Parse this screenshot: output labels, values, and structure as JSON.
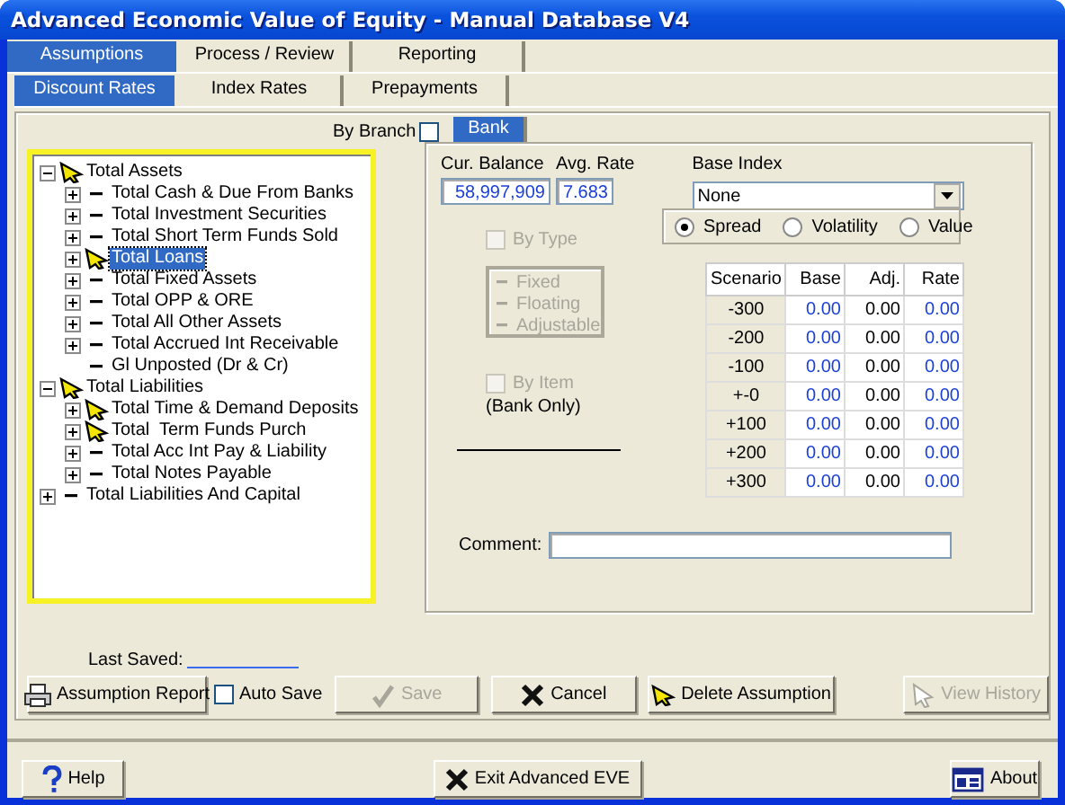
{
  "window": {
    "title": "Advanced Economic Value of Equity - Manual Database V4"
  },
  "tabs": [
    {
      "label": "Assumptions",
      "selected": true
    },
    {
      "label": "Process / Review",
      "selected": false
    },
    {
      "label": "Reporting",
      "selected": false
    }
  ],
  "subtabs": [
    {
      "label": "Discount Rates",
      "selected": true
    },
    {
      "label": "Index Rates",
      "selected": false
    },
    {
      "label": "Prepayments",
      "selected": false
    }
  ],
  "by_branch": {
    "label": "By Branch",
    "checked": false
  },
  "tree": [
    {
      "label": "Total Assets",
      "kind": "pointer",
      "expandable": true,
      "selected": false,
      "children": [
        {
          "label": "Total Cash & Due From Banks",
          "kind": "dash",
          "expandable": true,
          "selected": false
        },
        {
          "label": "Total Investment Securities",
          "kind": "dash",
          "expandable": true,
          "selected": false
        },
        {
          "label": "Total Short Term Funds Sold",
          "kind": "dash",
          "expandable": true,
          "selected": false
        },
        {
          "label": "Total Loans",
          "kind": "pointer",
          "expandable": true,
          "selected": true
        },
        {
          "label": "Total Fixed Assets",
          "kind": "dash",
          "expandable": true,
          "selected": false
        },
        {
          "label": "Total OPP & ORE",
          "kind": "dash",
          "expandable": true,
          "selected": false
        },
        {
          "label": "Total All Other Assets",
          "kind": "dash",
          "expandable": true,
          "selected": false
        },
        {
          "label": "Total Accrued Int Receivable",
          "kind": "dash",
          "expandable": true,
          "selected": false
        },
        {
          "label": "Gl Unposted (Dr & Cr)",
          "kind": "dash",
          "expandable": false,
          "selected": false
        }
      ]
    },
    {
      "label": "Total Liabilities",
      "kind": "pointer",
      "expandable": true,
      "selected": false,
      "children": [
        {
          "label": "Total Time & Demand Deposits",
          "kind": "pointer",
          "expandable": true,
          "selected": false
        },
        {
          "label": "Total  Term Funds Purch",
          "kind": "pointer",
          "expandable": true,
          "selected": false
        },
        {
          "label": "Total Acc Int Pay & Liability",
          "kind": "dash",
          "expandable": true,
          "selected": false
        },
        {
          "label": "Total Notes Payable",
          "kind": "dash",
          "expandable": true,
          "selected": false
        }
      ]
    },
    {
      "label": "Total Liabilities And Capital",
      "kind": "dash",
      "expandable": true,
      "selected": false
    }
  ],
  "panel": {
    "tab": "Bank",
    "cur_balance": {
      "label": "Cur. Balance",
      "value": "58,997,909"
    },
    "avg_rate": {
      "label": "Avg. Rate",
      "value": "7.683"
    },
    "base_index": {
      "label": "Base Index",
      "value": "None"
    },
    "by_type": {
      "label": "By Type",
      "checked": false,
      "disabled": true
    },
    "types": [
      "Fixed",
      "Floating",
      "Adjustable"
    ],
    "modes": [
      {
        "label": "Spread",
        "selected": true
      },
      {
        "label": "Volatility",
        "selected": false
      },
      {
        "label": "Value",
        "selected": false
      }
    ],
    "table": {
      "columns": [
        {
          "label": "Scenario",
          "kind": "label"
        },
        {
          "label": "Base",
          "kind": "computed"
        },
        {
          "label": "Adj.",
          "kind": "input"
        },
        {
          "label": "Rate",
          "kind": "computed"
        }
      ],
      "rows": [
        [
          "-300",
          "0.00",
          "0.00",
          "0.00"
        ],
        [
          "-200",
          "0.00",
          "0.00",
          "0.00"
        ],
        [
          "-100",
          "0.00",
          "0.00",
          "0.00"
        ],
        [
          "+-0",
          "0.00",
          "0.00",
          "0.00"
        ],
        [
          "+100",
          "0.00",
          "0.00",
          "0.00"
        ],
        [
          "+200",
          "0.00",
          "0.00",
          "0.00"
        ],
        [
          "+300",
          "0.00",
          "0.00",
          "0.00"
        ]
      ]
    },
    "by_item": {
      "label": "By Item",
      "checked": false,
      "disabled": true
    },
    "by_item_note": "(Bank Only)",
    "comment": {
      "label": "Comment:"
    }
  },
  "last_saved": {
    "label": "Last Saved:"
  },
  "actions": [
    {
      "label": "Assumption Report",
      "kind": "button",
      "disabled": false
    },
    {
      "label": "Auto Save",
      "kind": "checkbox",
      "checked": false
    },
    {
      "label": "Save",
      "kind": "button",
      "disabled": true
    },
    {
      "label": "Cancel",
      "kind": "button",
      "disabled": false
    },
    {
      "label": "Delete Assumption",
      "kind": "button",
      "disabled": false
    },
    {
      "label": "View History",
      "kind": "button",
      "disabled": true
    }
  ],
  "footer": [
    {
      "label": "Help"
    },
    {
      "label": "Exit Advanced EVE"
    },
    {
      "label": "About"
    }
  ]
}
